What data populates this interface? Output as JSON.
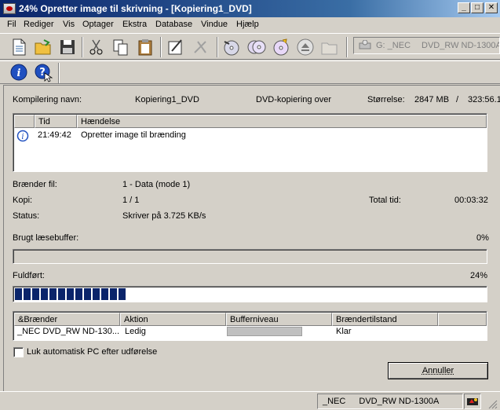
{
  "window": {
    "title": "24% Opretter image til skrivning - [Kopiering1_DVD]",
    "minimize": "_",
    "maximize": "□",
    "close": "✕"
  },
  "menu": [
    "Fil",
    "Rediger",
    "Vis",
    "Optager",
    "Ekstra",
    "Database",
    "Vindue",
    "Hjælp"
  ],
  "toolbar": {
    "drive_combo": {
      "drive": "G: _NEC",
      "model": "DVD_RW ND-1300A"
    }
  },
  "job": {
    "compile_name_label": "Kompilering navn:",
    "compile_name": "Kopiering1_DVD",
    "mode": "DVD-kopiering over",
    "size_label": "Størrelse:",
    "size_value": "2847 MB",
    "size_sep": "/",
    "size_total": "323:56.1"
  },
  "log": {
    "columns": [
      "Tid",
      "Hændelse"
    ],
    "rows": [
      {
        "time": "21:49:42",
        "event": "Opretter image til brænding"
      }
    ]
  },
  "details": {
    "burner_file_label": "Brænder fil:",
    "burner_file": "1 - Data (mode 1)",
    "copy_label": "Kopi:",
    "copy": "1 / 1",
    "total_time_label": "Total tid:",
    "total_time": "00:03:32",
    "status_label": "Status:",
    "status": "Skriver på 3.725 KB/s"
  },
  "buffer": {
    "label": "Brugt læsebuffer:",
    "percent_text": "0%",
    "fraction": 0
  },
  "completed": {
    "label": "Fuldført:",
    "percent_text": "24%",
    "fraction": 0.24
  },
  "burners": {
    "columns": [
      "&Brænder",
      "Aktion",
      "Bufferniveau",
      "Brændertilstand"
    ],
    "rows": [
      {
        "burner": "_NEC DVD_RW ND-130...",
        "action": "Ledig",
        "state": "Klar"
      }
    ]
  },
  "auto_shutdown_label": "Luk automatisk PC efter udførelse",
  "cancel_button": "Annuller",
  "statusbar": {
    "drive": "_NEC",
    "model": "DVD_RW ND-1300A"
  },
  "colors": {
    "progress": "#0a246a",
    "titlebar": "#0a246a"
  }
}
